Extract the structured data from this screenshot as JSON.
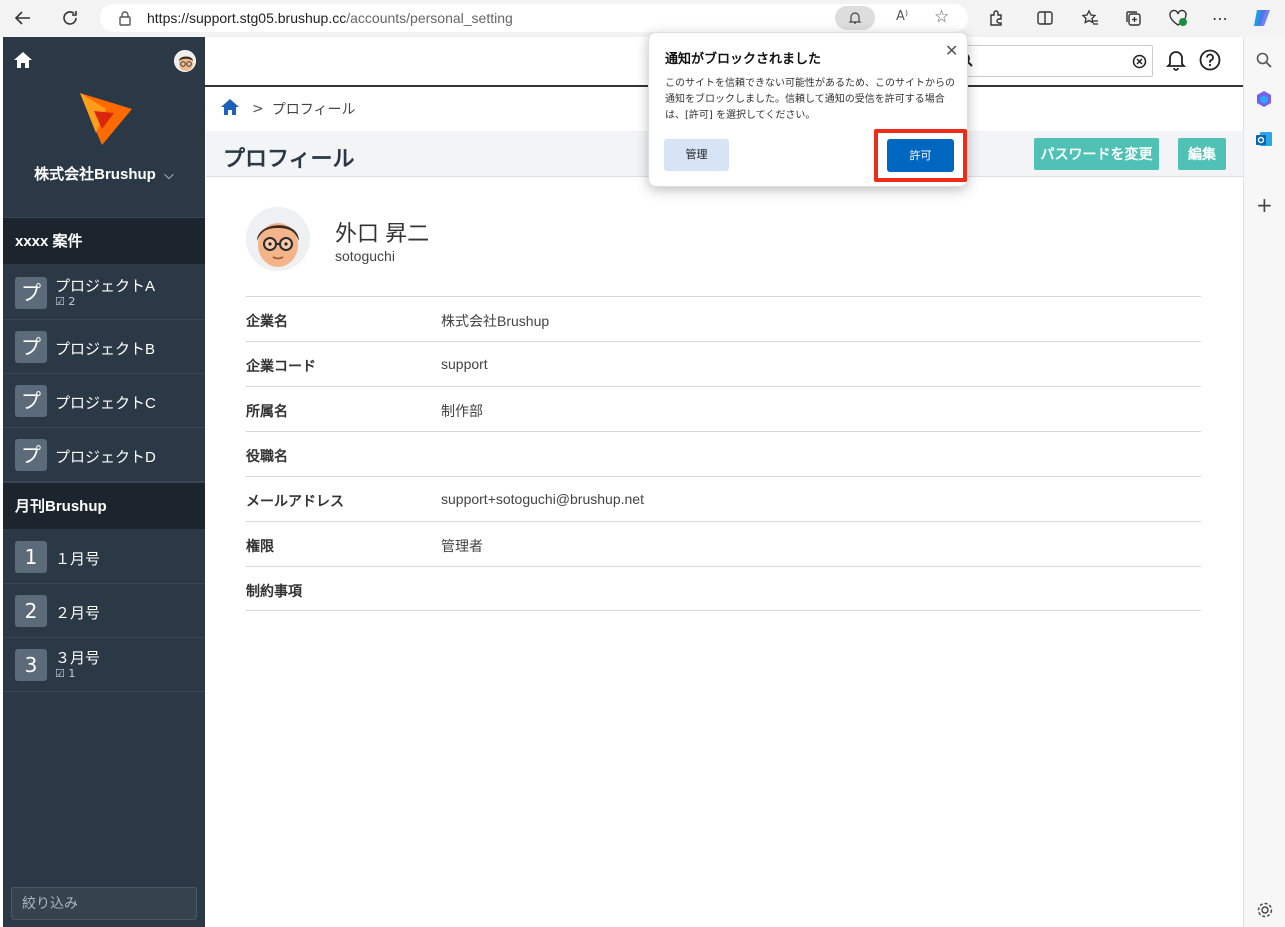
{
  "browser": {
    "url_host": "https://support.stg05.brushup.cc",
    "url_path": "/accounts/personal_setting"
  },
  "sidebar": {
    "company": "株式会社Brushup",
    "sections": [
      {
        "title": "xxxx 案件",
        "items": [
          {
            "badge": "プ",
            "label": "プロジェクトA",
            "sub": "2"
          },
          {
            "badge": "プ",
            "label": "プロジェクトB",
            "sub": ""
          },
          {
            "badge": "プ",
            "label": "プロジェクトC",
            "sub": ""
          },
          {
            "badge": "プ",
            "label": "プロジェクトD",
            "sub": ""
          }
        ]
      },
      {
        "title": "月刊Brushup",
        "items": [
          {
            "badge": "1",
            "label": "１月号",
            "sub": ""
          },
          {
            "badge": "2",
            "label": "２月号",
            "sub": ""
          },
          {
            "badge": "3",
            "label": "３月号",
            "sub": "1"
          }
        ]
      }
    ],
    "filter_placeholder": "絞り込み"
  },
  "breadcrumb": {
    "current": "プロフィール"
  },
  "page": {
    "title": "プロフィール",
    "change_password_label": "パスワードを変更",
    "edit_label": "編集"
  },
  "profile": {
    "name": "外口 昇二",
    "username": "sotoguchi",
    "fields": [
      {
        "key": "企業名",
        "value": "株式会社Brushup"
      },
      {
        "key": "企業コード",
        "value": "support"
      },
      {
        "key": "所属名",
        "value": "制作部"
      },
      {
        "key": "役職名",
        "value": ""
      },
      {
        "key": "メールアドレス",
        "value": "support+sotoguchi@brushup.net"
      },
      {
        "key": "権限",
        "value": "管理者"
      },
      {
        "key": "制約事項",
        "value": ""
      }
    ]
  },
  "popup": {
    "title": "通知がブロックされました",
    "message": "このサイトを信頼できない可能性があるため、このサイトからの通知をブロックしました。信頼して通知の受信を許可する場合は、[許可] を選択してください。",
    "manage_label": "管理",
    "allow_label": "許可"
  },
  "colors": {
    "sidebar_bg": "#2b3845",
    "accent_teal": "#4fc1b5",
    "allow_blue": "#0067c0",
    "highlight_red": "#ef2b1a"
  }
}
